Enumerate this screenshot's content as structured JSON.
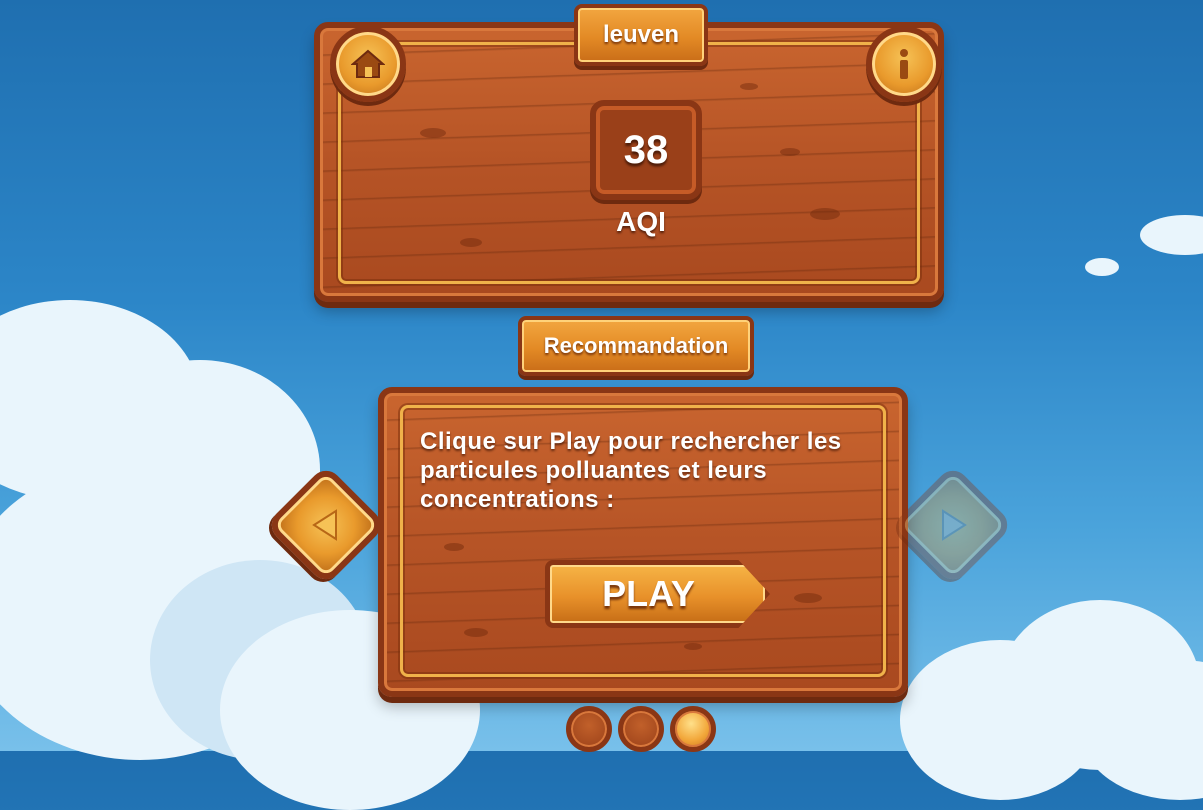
{
  "city": {
    "name": "leuven"
  },
  "aqi": {
    "value": "38",
    "label": "AQI"
  },
  "recommendation": {
    "title": "Recommandation",
    "text": "Clique sur Play pour rechercher les particules polluantes et leurs concentrations :"
  },
  "play_button": {
    "label": "PLAY"
  },
  "icons": {
    "home": "home-icon",
    "info": "info-icon",
    "prev": "arrow-left-icon",
    "next": "arrow-right-icon"
  },
  "pagination": {
    "pages": 3,
    "active_index": 2
  },
  "colors": {
    "wood": "#b65426",
    "accent": "#f2a640",
    "sky": "#2c86c8"
  }
}
